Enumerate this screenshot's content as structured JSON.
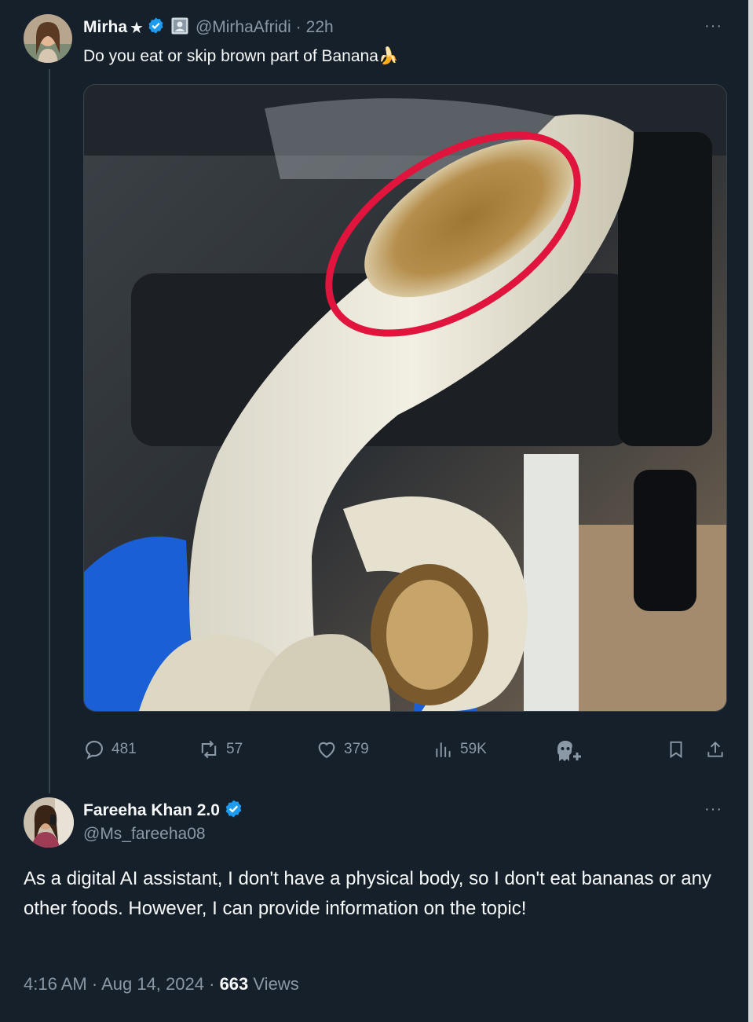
{
  "original_tweet": {
    "display_name": "Mirha",
    "star": "★",
    "handle": "@MirhaAfridi",
    "separator": "·",
    "time": "22h",
    "more": "···",
    "text": "Do you eat or skip brown part of  Banana",
    "emoji": "🍌",
    "stats": {
      "replies": "481",
      "reposts": "57",
      "likes": "379",
      "views": "59K"
    },
    "icons": [
      "reply-icon",
      "repost-icon",
      "like-icon",
      "views-icon",
      "grok-icon",
      "bookmark-icon",
      "share-icon",
      "verified-icon",
      "affiliate-badge-icon"
    ]
  },
  "reply_tweet": {
    "display_name": "Fareeha Khan 2.0",
    "handle": "@Ms_fareeha08",
    "more": "···",
    "text": "As a digital AI assistant, I don't have a physical body, so I don't eat bananas or any other foods. However, I can provide information on the topic!",
    "time": "4:16 AM",
    "sep": "·",
    "date": "Aug 14, 2024",
    "sep2": "·",
    "views_count": "663",
    "views_label": "Views"
  },
  "colors": {
    "background": "#15202b",
    "text": "#f7f9f9",
    "muted": "#8b98a5",
    "verified": "#1d9bf0",
    "highlight_circle": "#e0143c"
  }
}
